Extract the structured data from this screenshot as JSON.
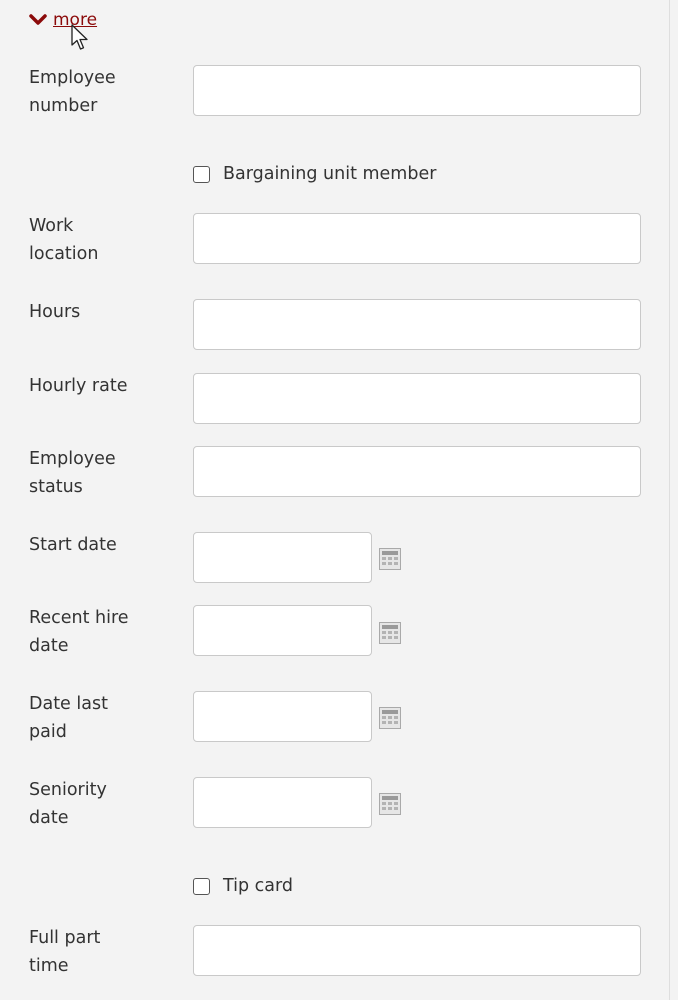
{
  "more_toggle": {
    "label": "more",
    "icon": "chevron-down-icon",
    "color": "#8b0a0a"
  },
  "fields": {
    "employee_number": {
      "label": "Employee\nnumber",
      "value": ""
    },
    "bargaining_unit": {
      "label": "Bargaining unit member",
      "checked": false
    },
    "work_location": {
      "label": "Work\nlocation",
      "value": ""
    },
    "hours": {
      "label": "Hours",
      "value": ""
    },
    "hourly_rate": {
      "label": "Hourly rate",
      "value": ""
    },
    "employee_status": {
      "label": "Employee\nstatus",
      "value": ""
    },
    "start_date": {
      "label": "Start date",
      "value": "",
      "icon": "calendar-icon"
    },
    "recent_hire_date": {
      "label": "Recent hire\ndate",
      "value": "",
      "icon": "calendar-icon"
    },
    "date_last_paid": {
      "label": "Date last\npaid",
      "value": "",
      "icon": "calendar-icon"
    },
    "seniority_date": {
      "label": "Seniority\ndate",
      "value": "",
      "icon": "calendar-icon"
    },
    "tip_card": {
      "label": "Tip card",
      "checked": false
    },
    "full_part_time": {
      "label": "Full part\ntime",
      "value": ""
    }
  }
}
